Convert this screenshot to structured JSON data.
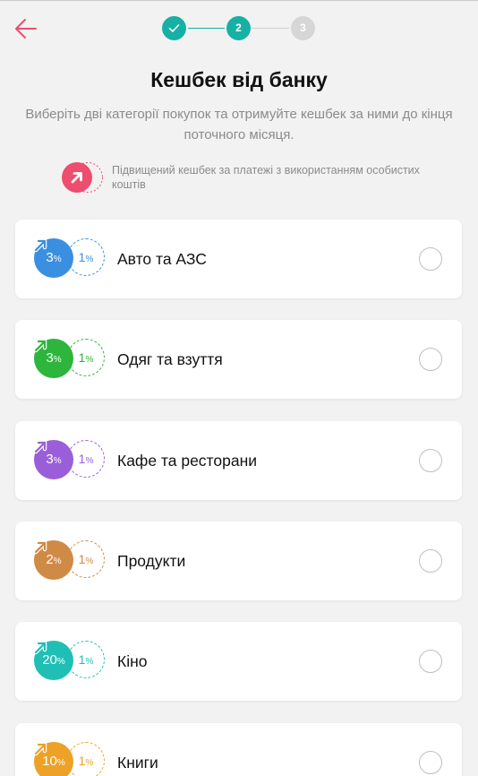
{
  "stepper": {
    "steps": [
      {
        "label": "",
        "state": "done"
      },
      {
        "label": "2",
        "state": "current"
      },
      {
        "label": "3",
        "state": "pending"
      }
    ]
  },
  "header": {
    "title": "Кешбек від банку",
    "subtitle": "Виберіть дві категорії покупок та отримуйте кешбек за ними до кінця поточного місяця."
  },
  "hint": {
    "text": "Підвищений кешбек за платежі з використанням особистих коштів",
    "color": "#ee4d6e"
  },
  "categories": [
    {
      "label": "Авто та АЗС",
      "high": "3",
      "base": "1",
      "color": "#3a8fe0",
      "selected": false
    },
    {
      "label": "Одяг та взуття",
      "high": "3",
      "base": "1",
      "color": "#2db53c",
      "selected": false
    },
    {
      "label": "Кафе та ресторани",
      "high": "3",
      "base": "1",
      "color": "#9a5fd8",
      "selected": false
    },
    {
      "label": "Продукти",
      "high": "2",
      "base": "1",
      "color": "#cf8a45",
      "selected": false
    },
    {
      "label": "Кіно",
      "high": "20",
      "base": "1",
      "color": "#1fbfb5",
      "selected": false
    },
    {
      "label": "Книги",
      "high": "10",
      "base": "1",
      "color": "#eda127",
      "selected": false
    }
  ],
  "percent_sign": "%",
  "colors": {
    "accent": "#17b0a5",
    "back_arrow": "#ee4d6e"
  }
}
